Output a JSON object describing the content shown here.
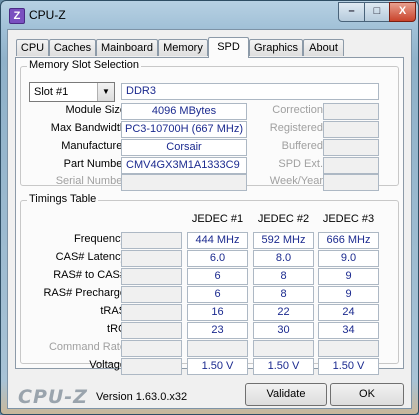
{
  "window": {
    "title": "CPU-Z",
    "icon_letter": "Z",
    "min": "–",
    "max": "□",
    "close": "X"
  },
  "tabs": [
    "CPU",
    "Caches",
    "Mainboard",
    "Memory",
    "SPD",
    "Graphics",
    "About"
  ],
  "active_tab": "SPD",
  "memory_slot": {
    "group_title": "Memory Slot Selection",
    "slot_selected": "Slot #1",
    "type": "DDR3",
    "labels": {
      "module_size": "Module Size",
      "max_bandwidth": "Max Bandwidth",
      "manufacturer": "Manufacturer",
      "part_number": "Part Number",
      "serial_number": "Serial Number",
      "correction": "Correction",
      "registered": "Registered",
      "buffered": "Buffered",
      "spd_ext": "SPD Ext.",
      "week_year": "Week/Year"
    },
    "values": {
      "module_size": "4096 MBytes",
      "max_bandwidth": "PC3-10700H (667 MHz)",
      "manufacturer": "Corsair",
      "part_number": "CMV4GX3M1A1333C9",
      "serial_number": "",
      "correction": "",
      "registered": "",
      "buffered": "",
      "spd_ext": "",
      "week_year": ""
    }
  },
  "timings": {
    "group_title": "Timings Table",
    "columns": [
      "JEDEC #1",
      "JEDEC #2",
      "JEDEC #3"
    ],
    "rows": [
      {
        "label": "Frequency",
        "dim": false,
        "values": [
          "444 MHz",
          "592 MHz",
          "666 MHz"
        ]
      },
      {
        "label": "CAS# Latency",
        "dim": false,
        "values": [
          "6.0",
          "8.0",
          "9.0"
        ]
      },
      {
        "label": "RAS# to CAS#",
        "dim": false,
        "values": [
          "6",
          "8",
          "9"
        ]
      },
      {
        "label": "RAS# Precharge",
        "dim": false,
        "values": [
          "6",
          "8",
          "9"
        ]
      },
      {
        "label": "tRAS",
        "dim": false,
        "values": [
          "16",
          "22",
          "24"
        ]
      },
      {
        "label": "tRC",
        "dim": false,
        "values": [
          "23",
          "30",
          "34"
        ]
      },
      {
        "label": "Command Rate",
        "dim": true,
        "values": [
          "",
          "",
          ""
        ]
      },
      {
        "label": "Voltage",
        "dim": false,
        "values": [
          "1.50 V",
          "1.50 V",
          "1.50 V"
        ]
      }
    ]
  },
  "footer": {
    "logo": "CPU-Z",
    "version": "Version 1.63.0.x32",
    "validate": "Validate",
    "ok": "OK"
  }
}
